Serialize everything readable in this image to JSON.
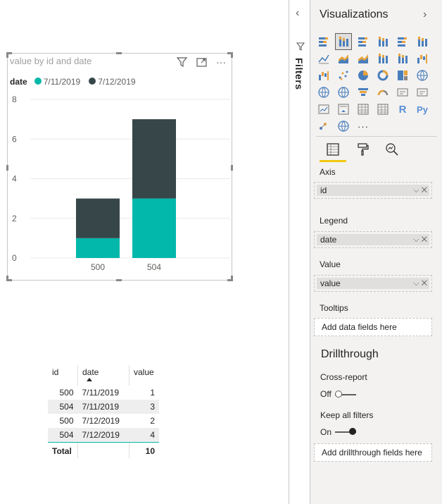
{
  "chart_data": {
    "type": "bar",
    "stacked": true,
    "title": "value by id and date",
    "categories": [
      "500",
      "504"
    ],
    "series": [
      {
        "name": "7/11/2019",
        "values": [
          1,
          3
        ],
        "color": "#01b8aa"
      },
      {
        "name": "7/12/2019",
        "values": [
          2,
          4
        ],
        "color": "#374649"
      }
    ],
    "ylim": [
      0,
      8
    ],
    "yticks": [
      "8",
      "6",
      "4",
      "2",
      "0"
    ],
    "legend_title": "date",
    "legend_position": "top-left",
    "grid": true
  },
  "table": {
    "headers": [
      "id",
      "date",
      "value"
    ],
    "rows": [
      [
        "500",
        "7/11/2019",
        "1"
      ],
      [
        "504",
        "7/11/2019",
        "3"
      ],
      [
        "500",
        "7/12/2019",
        "2"
      ],
      [
        "504",
        "7/12/2019",
        "4"
      ]
    ],
    "total_label": "Total",
    "total_value": "10"
  },
  "filters": {
    "label": "Filters",
    "icon": "filter-icon",
    "chevron": "chevron-left-icon"
  },
  "viz": {
    "title": "Visualizations",
    "more": "···",
    "r_label": "R",
    "py_label": "Py",
    "axis_label": "Axis",
    "axis_field": "id",
    "legend_label": "Legend",
    "legend_field": "date",
    "value_label": "Value",
    "value_field": "value",
    "tooltips_label": "Tooltips",
    "tooltips_placeholder": "Add data fields here",
    "drillthrough_title": "Drillthrough",
    "cross_report_label": "Cross-report",
    "cross_report_state": "Off",
    "keep_filters_label": "Keep all filters",
    "keep_filters_state": "On",
    "drill_placeholder": "Add drillthrough fields here",
    "chip_controls": "⌵ ✕"
  },
  "colors": {
    "accent": "#f2c811",
    "teal": "#01b8aa",
    "dark": "#374649"
  }
}
